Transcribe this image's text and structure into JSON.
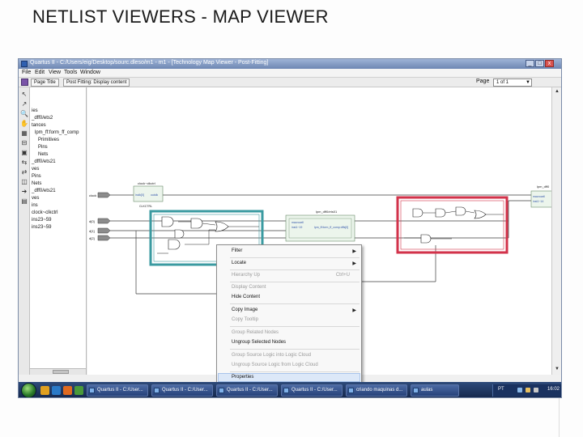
{
  "slide": {
    "title": "NETLIST VIEWERS - MAP VIEWER"
  },
  "window": {
    "title": "Quartus II - C:/Users/eig/Desktop/sourc.dleso/m1 - m1 - [Technology Map Viewer - Post-Fitting]",
    "minimize": "_",
    "maximize": "□",
    "close": "x"
  },
  "menu": {
    "file": "File",
    "edit": "Edit",
    "view": "View",
    "tools": "Tools",
    "window": "Window"
  },
  "toolbar": {
    "page_title": "Page Title",
    "post_fitting": "Post Fitting: Display content",
    "page_label": "Page",
    "page_value": "1 of 1"
  },
  "left_tools": [
    "↖",
    "↗",
    "🔍",
    "✋",
    "▦",
    "⊟",
    "▣",
    "⇆",
    "⇄",
    "◫",
    "➜",
    "▤"
  ],
  "hierarchy": [
    "ies",
    "_dff0/ets2",
    "tances",
    "lpm_ff:form_ff_comp",
    "Primitives",
    "Pins",
    "Nets",
    "_dff0/ets21",
    "ves",
    "Pins",
    "Nets",
    "_dff0/ets21",
    "ves",
    "ins",
    "clock~clkctrl",
    "ins23~59",
    "ins23~59"
  ],
  "schematic": {
    "in_pins": [
      "clock",
      "d[0]",
      "d[1]",
      "d[2]"
    ],
    "clkctrl_title": "clock~clkctrl",
    "clkctrl_in": "inclk[0]",
    "clkctrl_out": "outclk",
    "clkctrl_sub": "CLKCTRL",
    "mid_block_title": "lpm_dff0/ets01",
    "mid_block_line1": "macrocell",
    "mid_block_line2": "inst1~19",
    "mid_block_net": "lpm_ff:form_ff_comp:dffs[0]",
    "right_block_title": "lpm_dff0",
    "right_block_line1": "macrocell",
    "right_block_line2": "inst1~14"
  },
  "context_menu": {
    "filter": "Filter",
    "locate": "Locate",
    "hierarchy_up": "Hierarchy Up",
    "hierarchy_up_shortcut": "Ctrl+U",
    "display_content": "Display Content",
    "hide_content": "Hide Content",
    "copy_image": "Copy Image",
    "copy_tooltip": "Copy Tooltip",
    "group_related": "Group Related Nodes",
    "ungroup_selected": "Ungroup Selected Nodes",
    "group_source": "Group Source Logic into Logic Cloud",
    "ungroup_source": "Ungroup Source Logic from Logic Cloud",
    "properties": "Properties"
  },
  "taskbar": {
    "tasks": [
      "Quartus II - C:/User...",
      "Quartus II - C:/User...",
      "Quartus II - C:/User...",
      "Quartus II - C:/User...",
      "criando maquinas d...",
      "aulas"
    ],
    "lang": "PT",
    "clock": "16:02"
  },
  "colors": {
    "teal_box": "#3a9aa0",
    "red_box": "#d2324a",
    "wire": "#3c3c3c",
    "block_fill": "#ecf5ec",
    "block_border": "#6a8a6a"
  }
}
